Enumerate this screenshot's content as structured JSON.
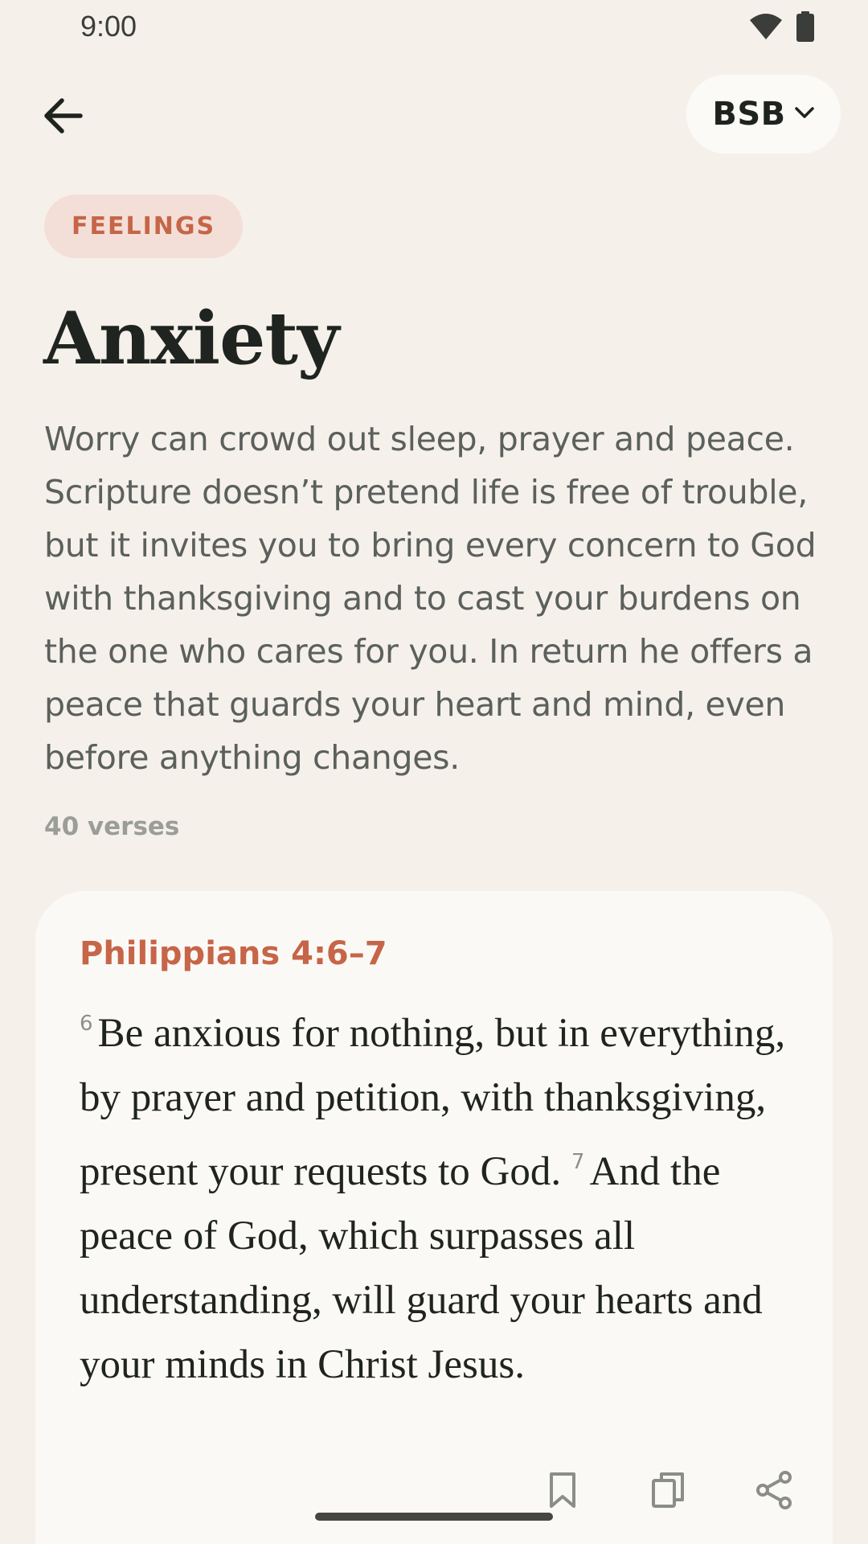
{
  "status_bar": {
    "time": "9:00",
    "icons": [
      "wifi-icon",
      "battery-icon"
    ]
  },
  "toolbar": {
    "back_icon": "arrow-left-icon",
    "version_label": "BSB",
    "version_icon": "chevron-down-icon"
  },
  "topic": {
    "category": "FEELINGS",
    "title": "Anxiety",
    "description": "Worry can crowd out sleep, prayer and peace. Scripture doesn’t pretend life is free of trouble, but it invites you to bring every concern to God with thanksgiving and to cast your burdens on the one who cares for you. In return he offers a peace that guards your heart and mind, even before anything changes.",
    "verse_count": "40 verses"
  },
  "verse_card": {
    "reference": "Philippians 4:6–7",
    "verses": [
      {
        "number": "6",
        "text": "Be anxious for nothing, but in everything, by prayer and petition, with thanksgiving, present your requests to God."
      },
      {
        "number": "7",
        "text": "And the peace of God, which surpasses all understanding, will guard your hearts and your minds in Christ Jesus."
      }
    ],
    "actions": [
      "bookmark-icon",
      "copy-icon",
      "share-icon"
    ]
  },
  "colors": {
    "background": "#f5f1ea",
    "accent": "#c66548",
    "chip_bg": "#f3dfd8",
    "card_bg": "#fbf9f6"
  }
}
